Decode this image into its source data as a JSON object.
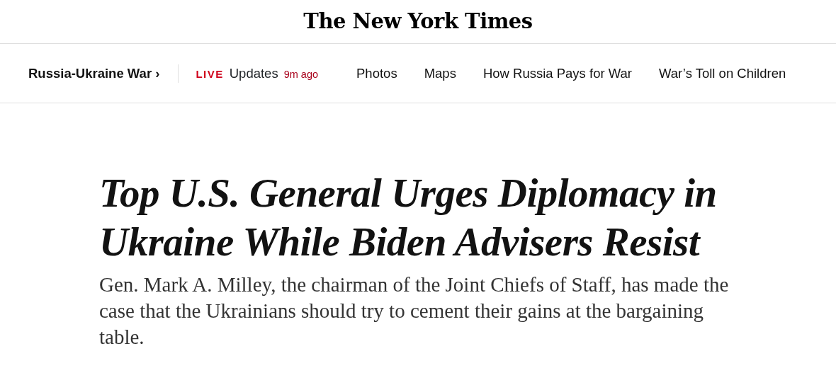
{
  "masthead": {
    "logo": "The New York Times"
  },
  "nav": {
    "section": "Russia-Ukraine War",
    "section_chevron": "›",
    "live": {
      "badge": "LIVE",
      "label": "Updates",
      "time": "9m ago"
    },
    "links": [
      "Photos",
      "Maps",
      "How Russia Pays for War",
      "War’s Toll on Children"
    ]
  },
  "article": {
    "headline": "Top U.S. General Urges Diplomacy in Ukraine While Biden Advisers Resist",
    "summary": "Gen. Mark A. Milley, the chairman of the Joint Chiefs of Staff, has made the case that the Ukrainians should try to cement their gains at the bargaining table."
  }
}
